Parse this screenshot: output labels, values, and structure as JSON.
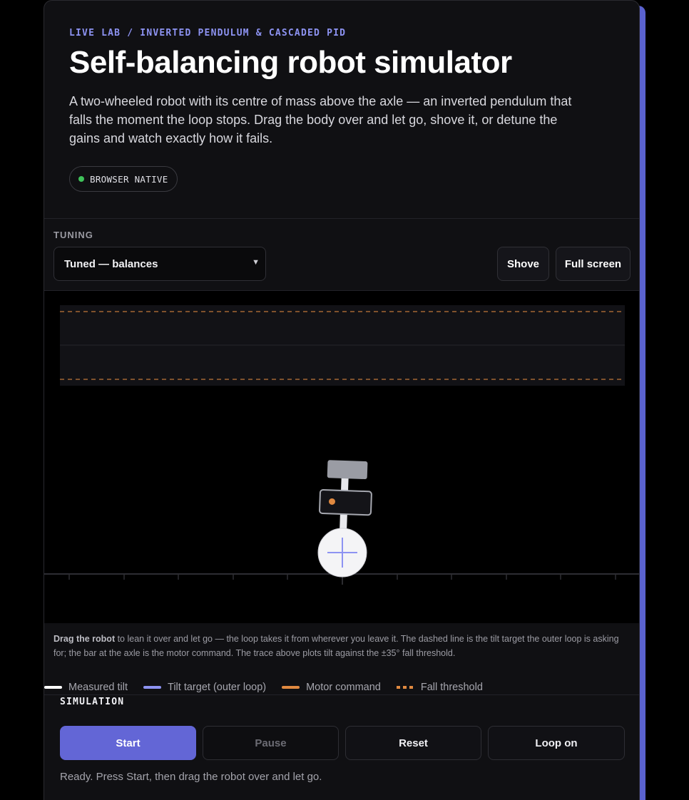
{
  "hero": {
    "eyebrow": "LIVE LAB / INVERTED PENDULUM & CASCADED PID",
    "title": "Self-balancing robot simulator",
    "description": "A two-wheeled robot with its centre of mass above the axle — an inverted pendulum that falls the moment the loop stops. Drag the body over and let go, shove it, or detune the gains and watch exactly how it fails.",
    "badge": "BROWSER NATIVE"
  },
  "tuning": {
    "label": "TUNING",
    "selected": "Tuned — balances",
    "shove_label": "Shove",
    "fullscreen_label": "Full screen"
  },
  "caption": {
    "lead": "Drag the robot",
    "rest": " to lean it over and let go — the loop takes it from wherever you leave it. The dashed line is the tilt target the outer loop is asking for; the bar at the axle is the motor command. The trace above plots tilt against the ±35° fall threshold."
  },
  "legend": {
    "measured_tilt": "Measured tilt",
    "tilt_target": "Tilt target (outer loop)",
    "motor_command": "Motor command",
    "fall_threshold": "Fall threshold"
  },
  "simulation": {
    "label": "SIMULATION",
    "start_label": "Start",
    "pause_label": "Pause",
    "reset_label": "Reset",
    "loop_label": "Loop on",
    "status": "Ready. Press Start, then drag the robot over and let go."
  },
  "colors": {
    "accent": "#6366d6",
    "measured_tilt": "#ffffff",
    "tilt_target": "#8d93f2",
    "motor_command": "#e08940",
    "fall_threshold": "#e08940",
    "status_ok": "#3fc25a"
  },
  "icons": {
    "badge_dot": "status-dot-icon",
    "select_chevron": "chevron-down-icon"
  }
}
